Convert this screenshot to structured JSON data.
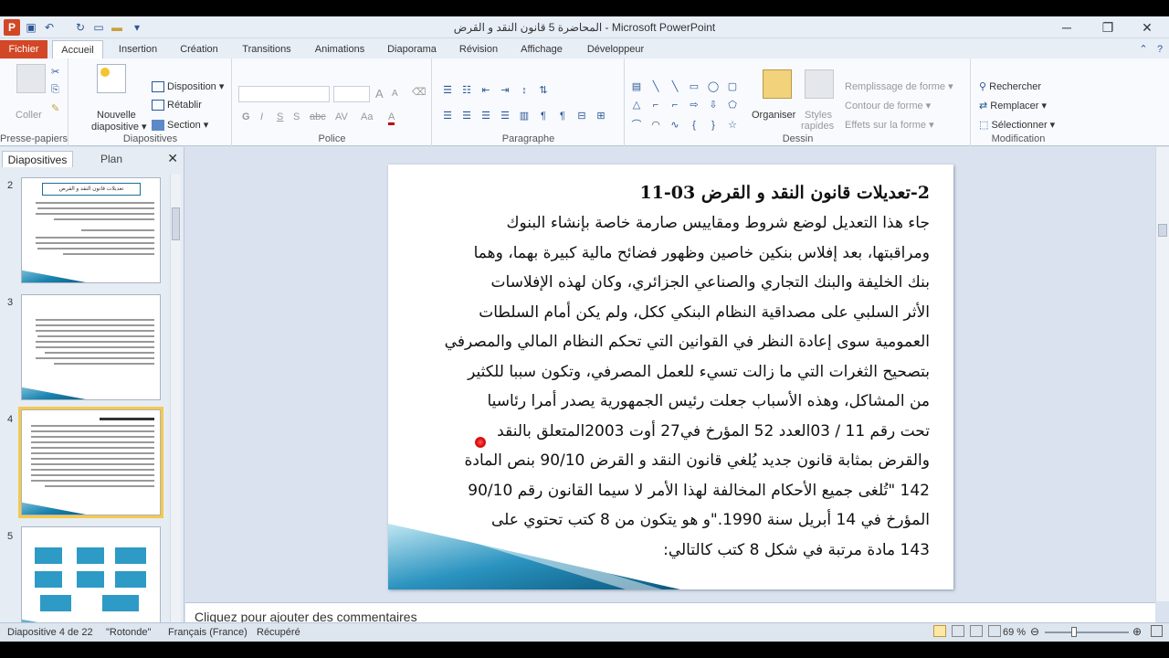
{
  "window": {
    "title": "المحاضرة 5 قانون النقد و القرض  -  Microsoft PowerPoint",
    "minimize": "─",
    "restore": "❐",
    "close": "✕"
  },
  "quick_access": {
    "app_icon": "P",
    "save": "💾",
    "undo": "↶",
    "redo": "↻",
    "new": "▭",
    "open": "📂",
    "more": "▾"
  },
  "tabs": [
    "Fichier",
    "Accueil",
    "Insertion",
    "Création",
    "Transitions",
    "Animations",
    "Diaporama",
    "Révision",
    "Affichage",
    "Développeur"
  ],
  "ribbon": {
    "clipboard": {
      "paste": "Coller",
      "label": "Presse-papiers"
    },
    "slides": {
      "new_slide": "Nouvelle",
      "new_slide_2": "diapositive ▾",
      "layout": "Disposition ▾",
      "reset": "Rétablir",
      "section": "Section ▾",
      "label": "Diapositives"
    },
    "font": {
      "bold": "G",
      "italic": "I",
      "underline": "S",
      "strike": "abc",
      "shadow": "S",
      "spacing": "AV",
      "case": "Aa",
      "color": "A",
      "grow": "A",
      "shrink": "A",
      "label": "Police"
    },
    "paragraph": {
      "label": "Paragraphe"
    },
    "drawing": {
      "arrange": "Organiser",
      "styles": "Styles",
      "styles_2": "rapides",
      "fill": "Remplissage de forme ▾",
      "outline": "Contour de forme ▾",
      "effects": "Effets sur la forme ▾",
      "label": "Dessin"
    },
    "editing": {
      "find": "Rechercher",
      "replace": "Remplacer ▾",
      "select": "Sélectionner ▾",
      "label": "Modification"
    }
  },
  "left_panel": {
    "tab_slides": "Diapositives",
    "tab_outline": "Plan",
    "close": "✕",
    "thumbnails": [
      {
        "number": "2",
        "title": "تعديلات قانون النقد و القرض"
      },
      {
        "number": "3"
      },
      {
        "number": "4"
      },
      {
        "number": "5"
      }
    ]
  },
  "slide": {
    "heading": "2-تعديلات قانون النقد و القرض 03-11",
    "body_lines": [
      "جاء هذا التعديل لوضع شروط ومقاييس صارمة خاصة بإنشاء البنوك",
      "ومراقبتها، بعد إفلاس بنكين خاصين وظهور فضائح مالية كبيرة بهما، وهما",
      "بنك الخليفة والبنك التجاري والصناعي الجزائري، وكان لهذه الإفلاسات",
      "الأثر السلبي على مصداقية النظام البنكي ككل، ولم يكن أمام السلطات",
      "العمومية سوى إعادة النظر في القوانين التي تحكم النظام المالي والمصرفي",
      "بتصحيح الثغرات التي ما زالت تسيء للعمل المصرفي، وتكون سببا للكثير",
      "من المشاكل، وهذه الأسباب جعلت رئيس الجمهورية يصدر أمرا رئاسيا",
      "تحت رقم  11 / 03العدد 52 المؤرخ في27 أوت  2003المتعلق بالنقد",
      "والقرض بمثابة قانون جديد يُلغي قانون النقد و القرض 90/10 بنص المادة",
      "142 \"تُلغى جميع الأحكام المخالفة لهذا الأمر لا سيما القانون رقم 90/10",
      "المؤرخ في 14 أبريل سنة 1990.\"و هو يتكون من 8 كتب تحتوي على",
      "143 مادة مرتبة في شكل 8 كتب كالتالي:"
    ]
  },
  "notes": {
    "placeholder": "Cliquez pour ajouter des commentaires"
  },
  "status": {
    "slide_info": "Diapositive 4 de 22",
    "theme": "\"Rotonde\"",
    "language": "Français (France)",
    "recovered": "Récupéré",
    "zoom": "69 %"
  },
  "colors": {
    "file_tab": "#d24726",
    "accent": "#2b5797",
    "slide_wave": "#1a85b0",
    "selected_thumb": "#f6c94a"
  }
}
